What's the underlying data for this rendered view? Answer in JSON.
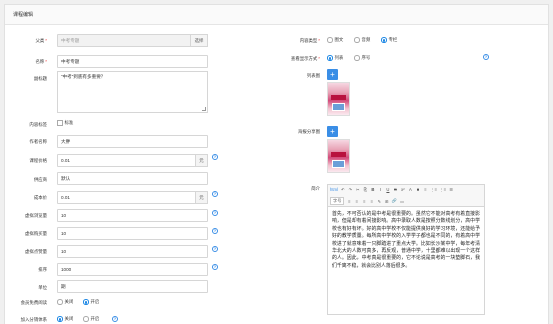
{
  "panel": {
    "title": "课程编辑"
  },
  "left": {
    "parent": {
      "label": "父类",
      "value": "中考专题",
      "button": "选择"
    },
    "name": {
      "label": "名称",
      "value": "中考专题"
    },
    "summary": {
      "label": "副标题",
      "value": "“中考”到底有多重要？"
    },
    "tags": {
      "label": "内容标签",
      "option": "标准"
    },
    "author": {
      "label": "作者名称",
      "value": "大胖"
    },
    "price": {
      "label": "课程价格",
      "value": "0.01",
      "unit": "元"
    },
    "vendor": {
      "label": "供应商",
      "value": "默认"
    },
    "cost": {
      "label": "成本价",
      "value": "0.01",
      "unit": "元"
    },
    "virtual_views": {
      "label": "虚拟浏览量",
      "value": "10"
    },
    "virtual_buys": {
      "label": "虚拟购买量",
      "value": "10"
    },
    "virtual_likes": {
      "label": "虚拟点赞量",
      "value": "10"
    },
    "sort": {
      "label": "排序",
      "value": "1000"
    },
    "unit": {
      "label": "单位",
      "value": "期"
    },
    "member_free": {
      "label": "会员免费阅读",
      "options": [
        "关闭",
        "开启"
      ],
      "selected": 1
    },
    "join_distribution": {
      "label": "加入分销体系",
      "options": [
        "关闭",
        "开启"
      ],
      "selected": 0
    }
  },
  "right": {
    "content_type": {
      "label": "内容类型",
      "options": [
        "图文",
        "音频",
        "专栏"
      ],
      "selected": 2
    },
    "display_mode": {
      "label": "查看显示方式",
      "options": [
        "列表",
        "序号"
      ],
      "selected": 0
    },
    "list_image": {
      "label": "列表图"
    },
    "share_image": {
      "label": "海报分享图"
    },
    "intro": {
      "label": "简介",
      "toolbar_row1": [
        "html",
        "↶",
        "↷",
        "✂",
        "⎘",
        "B",
        "I",
        "U",
        "S",
        "x²",
        "A",
        "■",
        "≡",
        "⋮≡",
        "⋮≡",
        "☰"
      ],
      "toolbar_font": "字号",
      "toolbar_row2": [
        "≡",
        "≡",
        "≡",
        "≡",
        "✎",
        "⊞",
        "🔗",
        "▭"
      ],
      "text": "首先，不可否认的是中考是很重要的。虽然它不能对高考有着直接影响，但是却有着间接影响。高中录取人数是按照分数线划分，高中学校也有好有坏。好的高中学校不仅能提供良好的学习环境，还能给予好的教学质量。每所高中学校的入学学子都也是不同的，有着高中学校进了就意味着一只脚踏进了重点大学。比如长沙某中学，每年考清华北大的人数可真多，再反观，普通中学，十里都难以出现一个这样的人。因此，中考真是很重要的，它不论说是高考的一块垫脚石，我们千离不稳，就会比别人落后很多。"
    }
  },
  "colors": {
    "accent": "#3a8ee6",
    "required": "#e33333"
  }
}
